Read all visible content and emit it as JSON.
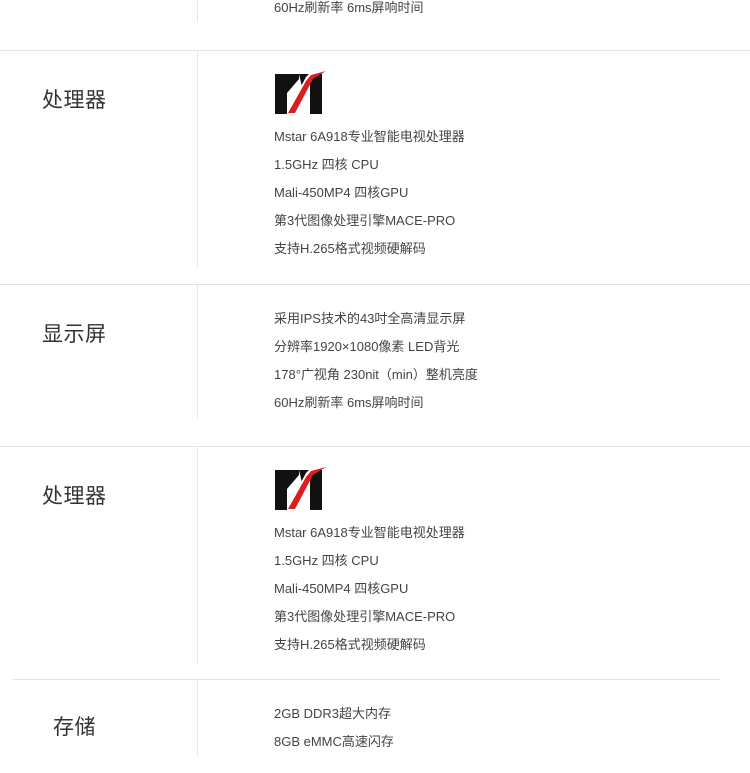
{
  "top_fragment": {
    "line": "60Hz刷新率 6ms屏响时间"
  },
  "processor_1": {
    "label": "处理器",
    "lines": [
      "Mstar 6A918专业智能电视处理器",
      "1.5GHz 四核 CPU",
      "Mali-450MP4 四核GPU",
      "第3代图像处理引擎MACE-PRO",
      "支持H.265格式视频硬解码"
    ],
    "logo_icon": "mstar-logo-icon",
    "logo_colors": {
      "black": "#111111",
      "red": "#d81e1e"
    }
  },
  "display": {
    "label": "显示屏",
    "lines": [
      "采用IPS技术的43吋全高清显示屏",
      "分辨率1920×1080像素 LED背光",
      "178°广视角 230nit（min）整机亮度",
      "60Hz刷新率 6ms屏响时间"
    ]
  },
  "processor_2": {
    "label": "处理器",
    "lines": [
      "Mstar 6A918专业智能电视处理器",
      "1.5GHz 四核 CPU",
      "Mali-450MP4 四核GPU",
      "第3代图像处理引擎MACE-PRO",
      "支持H.265格式视频硬解码"
    ],
    "logo_icon": "mstar-logo-icon"
  },
  "storage": {
    "label": "存储",
    "lines": [
      "2GB DDR3超大内存",
      "8GB eMMC高速闪存"
    ]
  }
}
